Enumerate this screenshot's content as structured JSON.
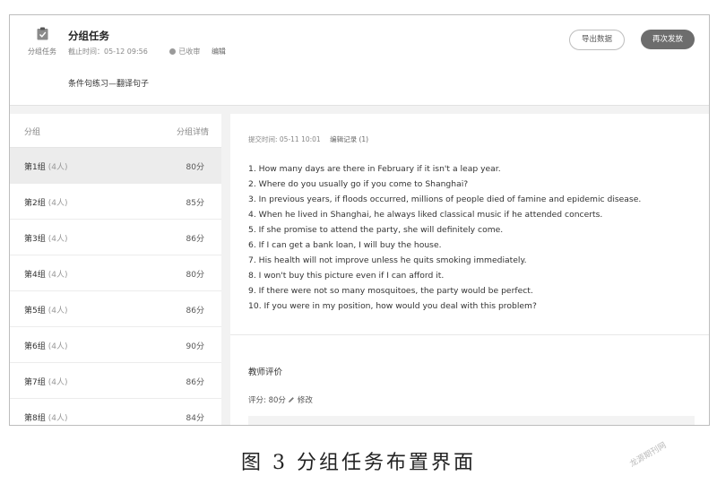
{
  "header": {
    "icon_label": "分组任务",
    "title": "分组任务",
    "deadline": "截止时间：05-12 09:56",
    "status": "已收审",
    "edit_label": "编辑",
    "description": "条件句练习—翻译句子",
    "export_button": "导出数据",
    "resend_button": "再次发放"
  },
  "groups": {
    "col_group": "分组",
    "col_detail": "分组详情",
    "items": [
      {
        "name": "第1组",
        "count": "(4人)",
        "score": "80分"
      },
      {
        "name": "第2组",
        "count": "(4人)",
        "score": "85分"
      },
      {
        "name": "第3组",
        "count": "(4人)",
        "score": "86分"
      },
      {
        "name": "第4组",
        "count": "(4人)",
        "score": "80分"
      },
      {
        "name": "第5组",
        "count": "(4人)",
        "score": "86分"
      },
      {
        "name": "第6组",
        "count": "(4人)",
        "score": "90分"
      },
      {
        "name": "第7组",
        "count": "(4人)",
        "score": "86分"
      },
      {
        "name": "第8组",
        "count": "(4人)",
        "score": "84分"
      }
    ]
  },
  "submission": {
    "submit_time": "提交时间: 05-11 10:01",
    "edit_history": "编辑记录 (1)",
    "sentences": [
      "1. How many days are there in February if it isn't a leap year.",
      "2. Where do you usually go if you come to Shanghai?",
      "3. In previous years, if floods occurred, millions of people died of famine and epidemic disease.",
      "4. When he lived in Shanghai, he always liked classical music if he attended concerts.",
      "5. If she promise to attend the party, she will definitely come.",
      "6. If I can get a bank loan, I will buy the house.",
      "7. His health will not improve unless he quits smoking immediately.",
      "8. I won't buy this picture even if I can afford it.",
      "9. If there were not so many mosquitoes, the party would be perfect.",
      "10. If you were in my position, how would you deal with this problem?"
    ]
  },
  "evaluation": {
    "title": "教师评价",
    "score_label": "评分:",
    "score_value": "80分",
    "modify_label": "修改"
  },
  "caption": "图 3   分组任务布置界面",
  "watermark": "龙源期刊网"
}
